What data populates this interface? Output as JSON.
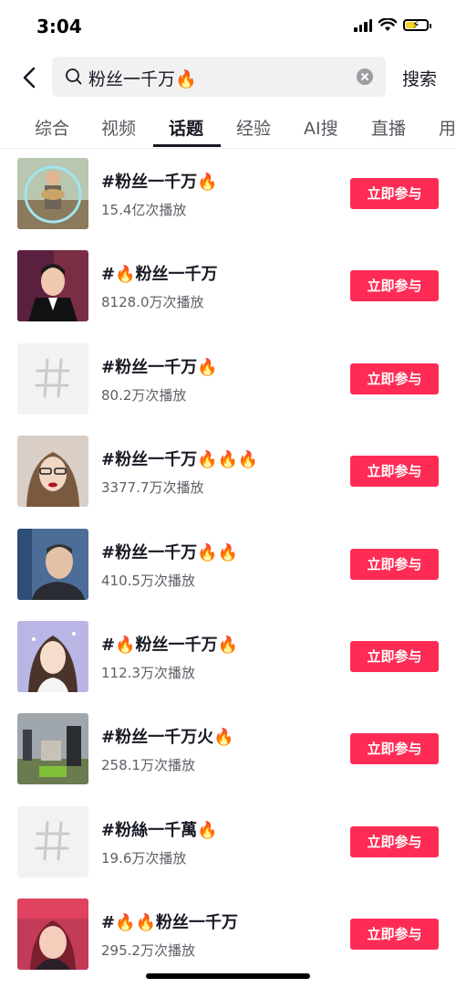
{
  "status_bar": {
    "time": "3:04"
  },
  "search": {
    "query": "粉丝一千万🔥",
    "submit_label": "搜索"
  },
  "tabs": [
    {
      "label": "综合"
    },
    {
      "label": "视频"
    },
    {
      "label": "话题",
      "active": true
    },
    {
      "label": "经验"
    },
    {
      "label": "AI搜"
    },
    {
      "label": "直播"
    },
    {
      "label": "用"
    }
  ],
  "topics": [
    {
      "title": "#粉丝一千万🔥",
      "plays": "15.4亿次播放",
      "button": "立即参与",
      "thumb": "photo"
    },
    {
      "title": "#🔥粉丝一千万",
      "plays": "8128.0万次播放",
      "button": "立即参与",
      "thumb": "photo"
    },
    {
      "title": "#粉丝一千万🔥",
      "plays": "80.2万次播放",
      "button": "立即参与",
      "thumb": "hash"
    },
    {
      "title": "#粉丝一千万🔥🔥🔥",
      "plays": "3377.7万次播放",
      "button": "立即参与",
      "thumb": "photo"
    },
    {
      "title": "#粉丝一千万🔥🔥",
      "plays": "410.5万次播放",
      "button": "立即参与",
      "thumb": "photo"
    },
    {
      "title": "#🔥粉丝一千万🔥",
      "plays": "112.3万次播放",
      "button": "立即参与",
      "thumb": "photo"
    },
    {
      "title": "#粉丝一千万火🔥",
      "plays": "258.1万次播放",
      "button": "立即参与",
      "thumb": "photo"
    },
    {
      "title": "#粉絲一千萬🔥",
      "plays": "19.6万次播放",
      "button": "立即参与",
      "thumb": "hash"
    },
    {
      "title": "#🔥🔥粉丝一千万",
      "plays": "295.2万次播放",
      "button": "立即参与",
      "thumb": "photo"
    }
  ],
  "colors": {
    "accent": "#fe2c55",
    "text": "#161823",
    "secondary": "#5e5f66"
  }
}
